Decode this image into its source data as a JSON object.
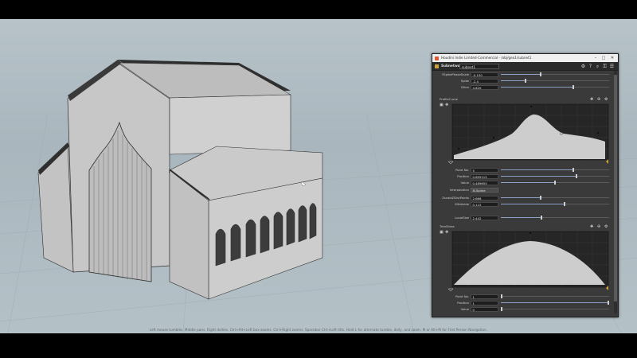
{
  "window": {
    "title": "Houdini Indie Limited-Commercial - /obj/geo1/subnet1"
  },
  "header": {
    "node_type": "Subnetwork",
    "node_name": "subnet1"
  },
  "params_top": [
    {
      "label": "YSpikePhaseScale",
      "value": "-0.150",
      "fraction": 0.36
    },
    {
      "label": "Spike",
      "value": "-2.4",
      "fraction": 0.22
    },
    {
      "label": "Dilon",
      "value": "4.820",
      "fraction": 0.66
    }
  ],
  "profile_curve": {
    "label": "ProfileCurve",
    "point_no": {
      "label": "Point No.",
      "value": "5",
      "fraction": 0.66
    },
    "position": {
      "label": "Position",
      "value": "0.695115",
      "fraction": 0.69
    },
    "value": {
      "label": "Value",
      "value": "0.489655",
      "fraction": 0.49
    },
    "interpolation": {
      "label": "Interpolation",
      "value": "B-Spline"
    },
    "extra": [
      {
        "label": "ZscaleZDistPoints",
        "value": "2.666",
        "fraction": 0.36
      },
      {
        "label": "MHdivide",
        "value": "0.115",
        "fraction": 0.58
      },
      {
        "label": "LocalSize",
        "value": "2.442",
        "fraction": 0.37
      }
    ],
    "points": [
      [
        0.0,
        0.1
      ],
      [
        0.2,
        0.3
      ],
      [
        0.42,
        0.55
      ],
      [
        0.55,
        0.98
      ],
      [
        0.695,
        0.49
      ],
      [
        0.9,
        0.27
      ],
      [
        1.0,
        0.1
      ]
    ]
  },
  "trim_curve": {
    "label": "TrimShine",
    "point_no": {
      "label": "Point No.",
      "value": "1",
      "fraction": 0.0
    },
    "position": {
      "label": "Position",
      "value": "1",
      "fraction": 0.99
    },
    "value": {
      "label": "Value",
      "value": "0",
      "fraction": 0.0
    }
  },
  "statusbar": {
    "text": "Left mouse tumbles. Middle pans. Right dollies. Ctrl+Alt+Left box-zooms. Ctrl+Right zooms. Spacebar Ctrl+Left tilts. Hold L for alternate tumble, dolly, and zoom.    M or Alt+M for First Person Navigation."
  },
  "colors": {
    "viewport_bg": "#b0bdc3",
    "ramp_fill": "#cdcdcd",
    "accent": "#8fa0c8"
  }
}
